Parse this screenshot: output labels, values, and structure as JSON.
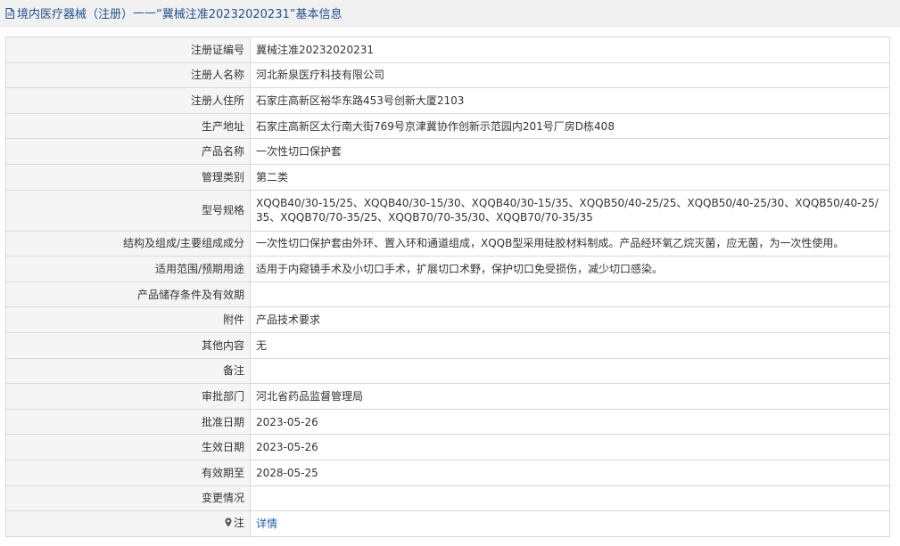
{
  "header": {
    "prefix": "境内医疗器械（注册）",
    "separator": " —— ",
    "title": "“冀械注准20232020231”基本信息"
  },
  "rows": [
    {
      "label": "注册证编号",
      "value": "冀械注准20232020231"
    },
    {
      "label": "注册人名称",
      "value": "河北新泉医疗科技有限公司"
    },
    {
      "label": "注册人住所",
      "value": "石家庄高新区裕华东路453号创新大厦2103"
    },
    {
      "label": "生产地址",
      "value": "石家庄高新区太行南大街769号京津冀协作创新示范园内201号厂房D栋408"
    },
    {
      "label": "产品名称",
      "value": "一次性切口保护套"
    },
    {
      "label": "管理类别",
      "value": "第二类"
    },
    {
      "label": "型号规格",
      "value": "XQQB40/30-15/25、XQQB40/30-15/30、XQQB40/30-15/35、XQQB50/40-25/25、XQQB50/40-25/30、XQQB50/40-25/35、XQQB70/70-35/25、XQQB70/70-35/30、XQQB70/70-35/35"
    },
    {
      "label": "结构及组成/主要组成成分",
      "value": "一次性切口保护套由外环、置入环和通道组成，XQQB型采用硅胶材料制成。产品经环氧乙烷灭菌，应无菌，为一次性使用。"
    },
    {
      "label": "适用范围/预期用途",
      "value": "适用于内窥镜手术及小切口手术，扩展切口术野，保护切口免受损伤，减少切口感染。"
    },
    {
      "label": "产品储存条件及有效期",
      "value": ""
    },
    {
      "label": "附件",
      "value": "产品技术要求"
    },
    {
      "label": "其他内容",
      "value": "无"
    },
    {
      "label": "备注",
      "value": ""
    },
    {
      "label": "审批部门",
      "value": "河北省药品监督管理局"
    },
    {
      "label": "批准日期",
      "value": "2023-05-26"
    },
    {
      "label": "生效日期",
      "value": "2023-05-26"
    },
    {
      "label": "有效期至",
      "value": "2028-05-25"
    },
    {
      "label": "变更情况",
      "value": ""
    }
  ],
  "note": {
    "label": "注",
    "link_text": "详情"
  },
  "colors": {
    "header_text": "#1f4e8c",
    "link": "#1f5fa8",
    "label_bg": "#f5f5f5",
    "border": "#d8d8d8"
  }
}
